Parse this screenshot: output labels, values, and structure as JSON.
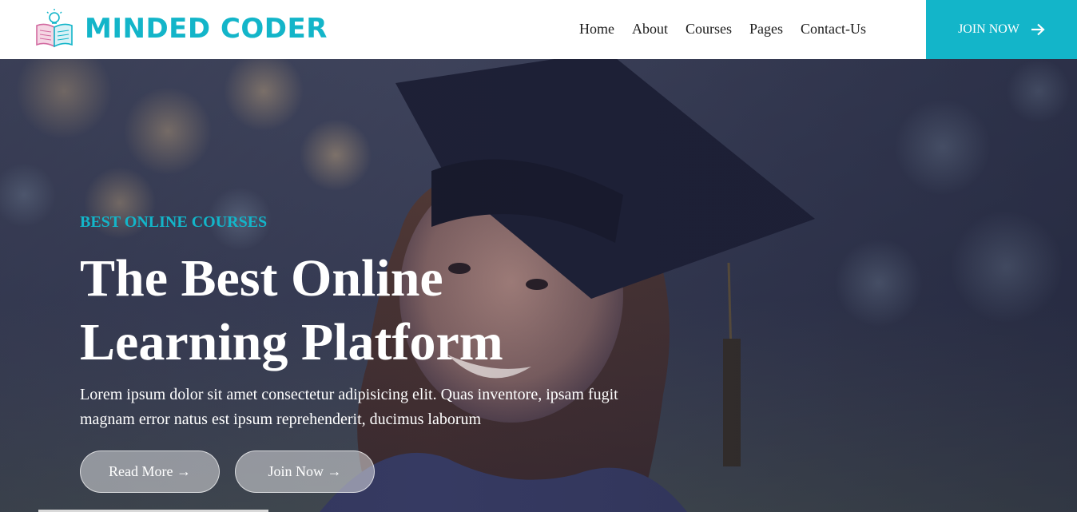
{
  "brand": {
    "name": "MINDED CODER",
    "logo_icon": "open-book-lightbulb-icon",
    "color": "#13b5c9"
  },
  "nav": {
    "items": [
      {
        "label": "Home"
      },
      {
        "label": "About"
      },
      {
        "label": "Courses"
      },
      {
        "label": "Pages"
      },
      {
        "label": "Contact-Us"
      }
    ],
    "join_label": "JOIN NOW",
    "join_icon": "arrow-right-icon"
  },
  "hero": {
    "eyebrow": "BEST ONLINE COURSES",
    "title": "The Best Online Learning Platform",
    "description": "Lorem ipsum dolor sit amet consectetur adipisicing elit. Quas inventore, ipsam fugit magnam error natus est ipsum reprehenderit, ducimus laborum",
    "buttons": {
      "read_more": "Read More →",
      "join_now": "Join Now →"
    },
    "background": "graduate-student-photo"
  },
  "colors": {
    "accent": "#13b5c9",
    "nav_text": "#1b1b1b"
  }
}
